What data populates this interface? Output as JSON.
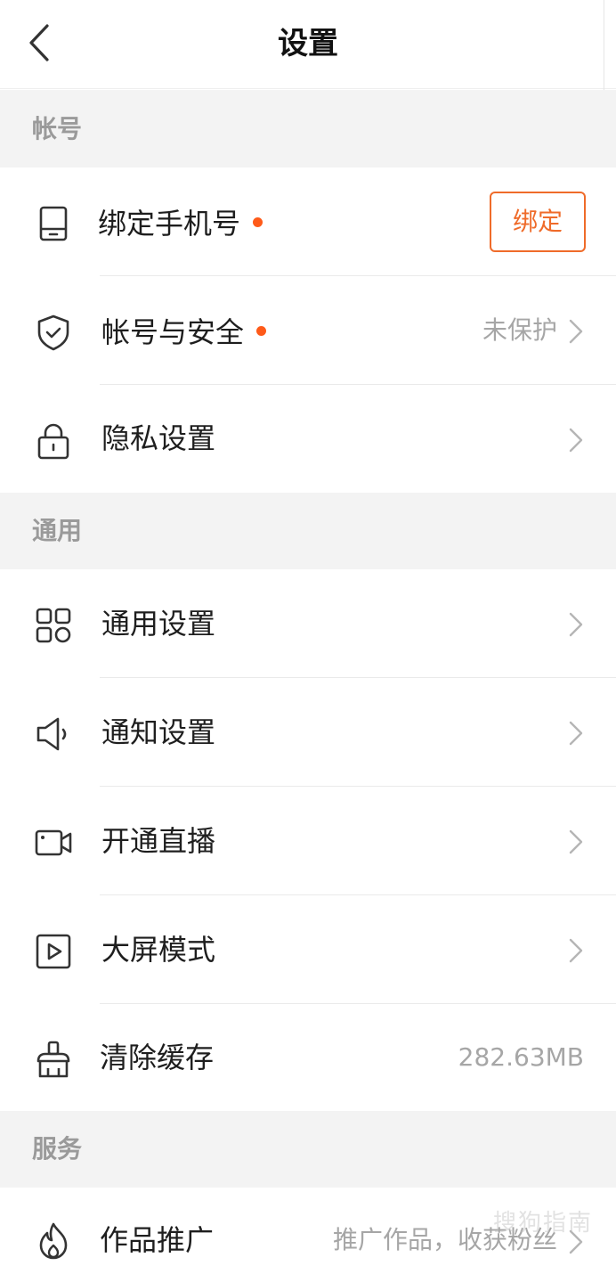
{
  "header": {
    "title": "设置"
  },
  "sections": {
    "account": "帐号",
    "general": "通用",
    "service": "服务"
  },
  "rows": {
    "bind_phone": {
      "label": "绑定手机号",
      "button": "绑定"
    },
    "account_security": {
      "label": "帐号与安全",
      "value": "未保护"
    },
    "privacy": {
      "label": "隐私设置"
    },
    "general_settings": {
      "label": "通用设置"
    },
    "notification": {
      "label": "通知设置"
    },
    "live": {
      "label": "开通直播"
    },
    "big_screen": {
      "label": "大屏模式"
    },
    "clear_cache": {
      "label": "清除缓存",
      "value": "282.63MB"
    },
    "promotion": {
      "label": "作品推广",
      "value": "推广作品，收获粉丝"
    }
  },
  "watermark": "搜狗指南",
  "colors": {
    "accent": "#fe5a19",
    "section_bg": "#f3f3f3",
    "muted_text": "#a6a6a6"
  },
  "icons": {
    "back": "chevron-left-icon",
    "bind_phone": "phone-icon",
    "account_security": "shield-check-icon",
    "privacy": "lock-icon",
    "general_settings": "grid-apps-icon",
    "notification": "speaker-icon",
    "live": "video-camera-icon",
    "big_screen": "play-screen-icon",
    "clear_cache": "brush-icon",
    "promotion": "flame-icon"
  }
}
